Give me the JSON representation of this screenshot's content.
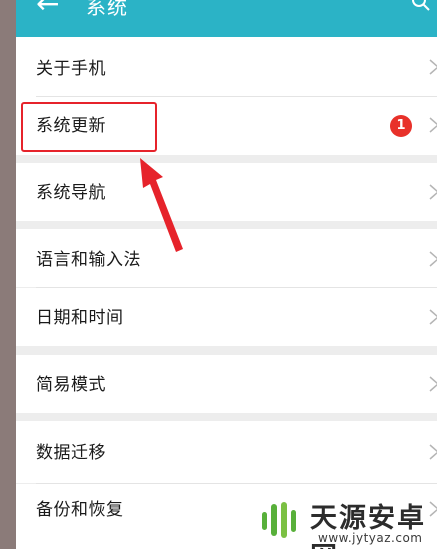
{
  "header": {
    "title": "系统",
    "back_icon": "arrow-left-icon",
    "search_icon": "search-icon",
    "color": "#2bb3c6"
  },
  "settings": {
    "items": [
      {
        "label": "关于手机"
      },
      {
        "label": "系统更新",
        "badge": "1"
      },
      {
        "label": "系统导航"
      },
      {
        "label": "语言和输入法"
      },
      {
        "label": "日期和时间"
      },
      {
        "label": "简易模式"
      },
      {
        "label": "数据迁移"
      },
      {
        "label": "备份和恢复"
      }
    ]
  },
  "annotation": {
    "highlight_color": "#e6232b",
    "highlighted_item": "系统更新"
  },
  "watermark": {
    "name": "天源安卓网",
    "url": "www.jytyaz.com"
  }
}
